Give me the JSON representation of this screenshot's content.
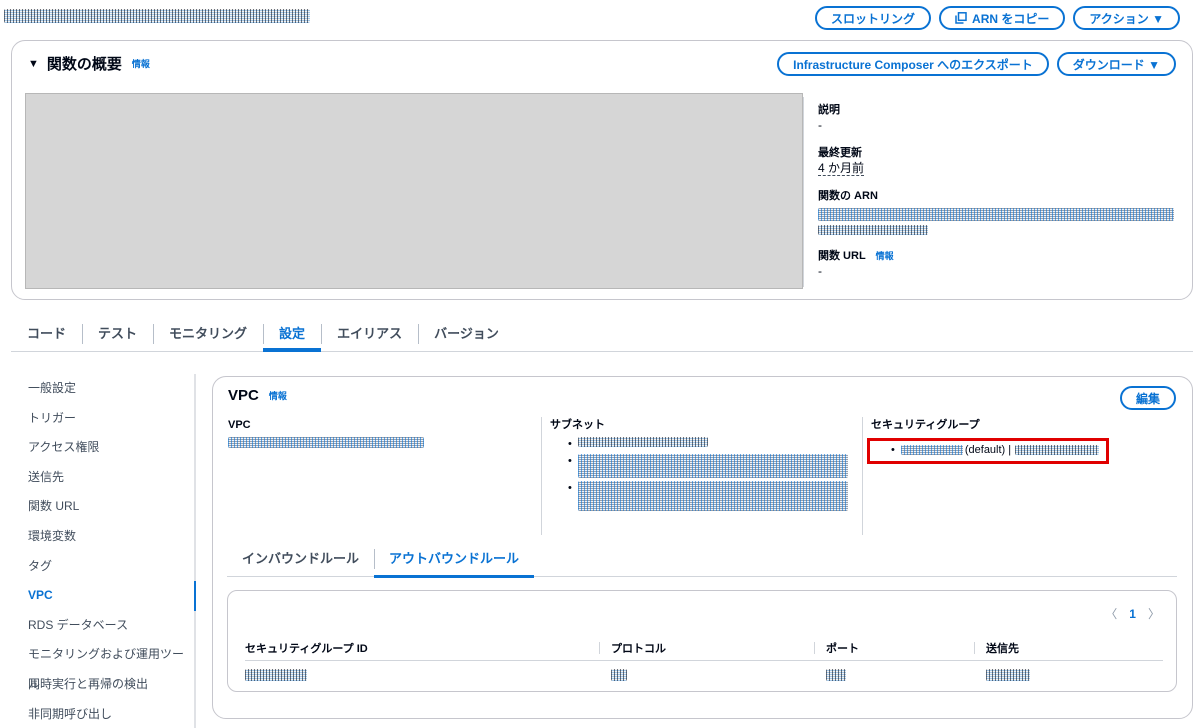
{
  "header": {
    "buttons": {
      "throttle": "スロットリング",
      "copy_arn": "ARN をコピー",
      "actions": "アクション ▼"
    },
    "icons": {
      "copy": "copy-icon"
    }
  },
  "overview": {
    "title": "関数の概要",
    "info": "情報",
    "export_button": "Infrastructure Composer へのエクスポート",
    "download_button": "ダウンロード ▼",
    "details": {
      "description_label": "説明",
      "description_value": "-",
      "last_modified_label": "最終更新",
      "last_modified_value": "4 か月前",
      "arn_label": "関数の ARN",
      "url_label": "関数 URL",
      "url_info": "情報",
      "url_value": "-"
    }
  },
  "tabs": [
    {
      "label": "コード"
    },
    {
      "label": "テスト"
    },
    {
      "label": "モニタリング"
    },
    {
      "label": "設定"
    },
    {
      "label": "エイリアス"
    },
    {
      "label": "バージョン"
    }
  ],
  "sidebar": {
    "items": [
      {
        "label": "一般設定"
      },
      {
        "label": "トリガー"
      },
      {
        "label": "アクセス権限"
      },
      {
        "label": "送信先"
      },
      {
        "label": "関数 URL"
      },
      {
        "label": "環境変数"
      },
      {
        "label": "タグ"
      },
      {
        "label": "VPC"
      },
      {
        "label": "RDS データベース"
      },
      {
        "label": "モニタリングおよび運用ツール"
      },
      {
        "label": "同時実行と再帰の検出"
      },
      {
        "label": "非同期呼び出し"
      }
    ]
  },
  "vpc": {
    "title": "VPC",
    "info": "情報",
    "edit_button": "編集",
    "vpc_label": "VPC",
    "subnet_label": "サブネット",
    "sg_label": "セキュリティグループ",
    "sg_default_text": "(default) |",
    "rule_tabs": [
      "インバウンドルール",
      "アウトバウンドルール"
    ],
    "pager": {
      "prev": "〈",
      "page": "1",
      "next": "〉"
    },
    "table_headers": [
      "セキュリティグループ ID",
      "プロトコル",
      "ポート",
      "送信先"
    ]
  },
  "colors": {
    "accent": "#0972d3",
    "highlight": "#e00000",
    "text": "#000716"
  }
}
